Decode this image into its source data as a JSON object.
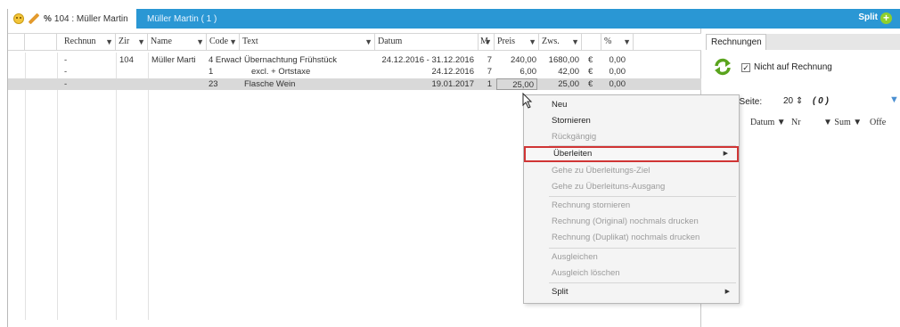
{
  "tabbar": {
    "active_tab": "104 : Müller Martin",
    "second_tab": "Müller Martin ( 1 )",
    "percent_symbol": "%",
    "split_label": "Split"
  },
  "grid": {
    "columns": [
      "Rechnun",
      "Zir",
      "Name",
      "Code",
      "Text",
      "Datum",
      "M",
      "Preis",
      "Zws.",
      "",
      "%"
    ],
    "rows": [
      {
        "rechnung": "-",
        "zimmer": "104",
        "name": "Müller Marti",
        "code": "4 Erwach",
        "text": "Übernachtung Frühstück",
        "datum": "24.12.2016 - 31.12.2016",
        "menge": "7",
        "preis": "240,00",
        "zws": "1680,00",
        "cur": "€",
        "pct": "0,00",
        "selected": false
      },
      {
        "rechnung": "-",
        "zimmer": "",
        "name": "",
        "code": "1",
        "text": "excl. + Ortstaxe",
        "datum": "24.12.2016",
        "menge": "7",
        "preis": "6,00",
        "zws": "42,00",
        "cur": "€",
        "pct": "0,00",
        "selected": false
      },
      {
        "rechnung": "-",
        "zimmer": "",
        "name": "",
        "code": "23",
        "text": "Flasche Wein",
        "datum": "19.01.2017",
        "menge": "1",
        "preis": "25,00",
        "zws": "25,00",
        "cur": "€",
        "pct": "0,00",
        "selected": true
      }
    ]
  },
  "right_panel": {
    "tab": "Rechnungen",
    "checkbox_label": "Nicht auf Rechnung",
    "checkbox_checked": true,
    "per_page_label": "/ Seite:",
    "per_page_value": "20",
    "count": "( 0 )",
    "headers": [
      "Datum",
      "Nr",
      "Sum",
      "Offe"
    ]
  },
  "context_menu": {
    "items": [
      {
        "label": "Neu",
        "disabled": false
      },
      {
        "label": "Stornieren",
        "disabled": false
      },
      {
        "label": "Rückgängig",
        "disabled": true
      },
      {
        "label": "Überleiten",
        "disabled": false,
        "submenu": true,
        "highlighted": true
      },
      {
        "label": "Gehe zu Überleitungs-Ziel",
        "disabled": true
      },
      {
        "label": "Gehe zu Überleituns-Ausgang",
        "disabled": true
      },
      {
        "label": "Rechnung stornieren",
        "disabled": true
      },
      {
        "label": "Rechnung (Original) nochmals drucken",
        "disabled": true
      },
      {
        "label": "Rechnung (Duplikat) nochmals drucken",
        "disabled": true
      },
      {
        "label": "Ausgleichen",
        "disabled": true
      },
      {
        "label": "Ausgleich löschen",
        "disabled": true
      },
      {
        "label": "Split",
        "disabled": false,
        "submenu": true
      }
    ]
  },
  "colors": {
    "tabbar": "#2a97d4",
    "highlight_border": "#d03535"
  },
  "icons": [
    "smiley-icon",
    "pencil-icon",
    "plus-icon",
    "refresh-icon",
    "filter-icon",
    "checkbox-icon",
    "submenu-arrow-icon",
    "mouse-cursor-icon"
  ]
}
